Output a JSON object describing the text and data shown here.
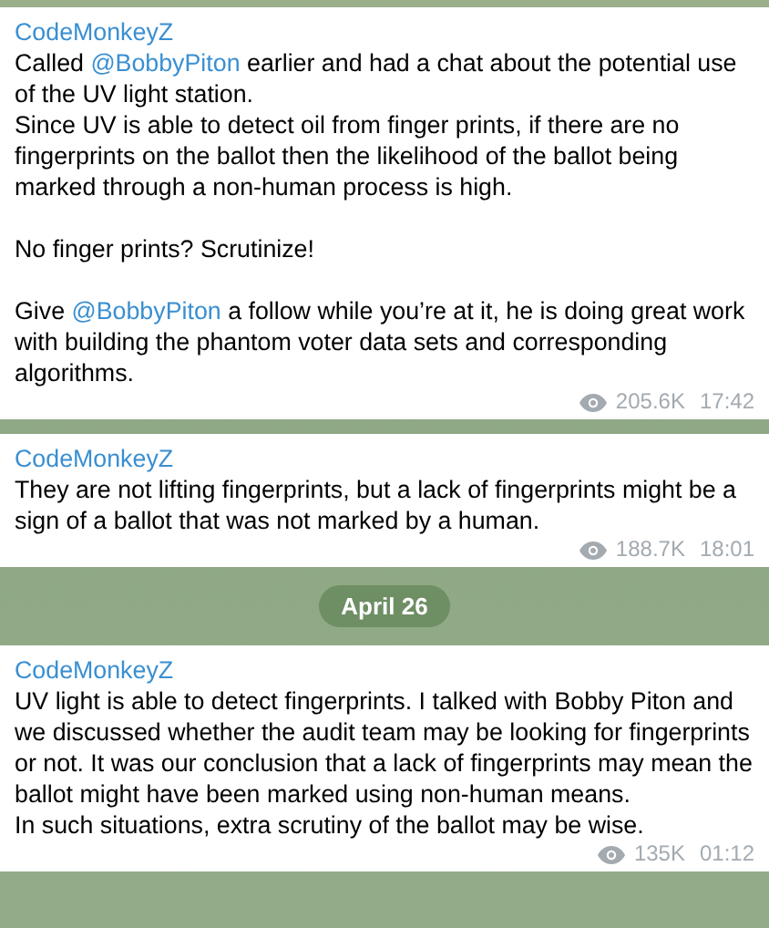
{
  "items": [
    {
      "kind": "message",
      "author": "CodeMonkeyZ",
      "groups": [
        [
          [
            {
              "kind": "plain",
              "text": "Called "
            },
            {
              "kind": "mention",
              "text": "@BobbyPiton"
            },
            {
              "kind": "plain",
              "text": " earlier and had a chat about the potential use of the UV light station."
            }
          ],
          [
            {
              "kind": "plain",
              "text": "Since UV is able to detect oil from finger prints, if there are no fingerprints on the ballot then the likelihood of the ballot being marked through a non-human process is high."
            }
          ]
        ],
        [
          [
            {
              "kind": "plain",
              "text": "No finger prints? Scrutinize!"
            }
          ]
        ],
        [
          [
            {
              "kind": "plain",
              "text": "Give "
            },
            {
              "kind": "mention",
              "text": "@BobbyPiton"
            },
            {
              "kind": "plain",
              "text": " a follow while you’re at it, he is doing great work with building the phantom voter data sets and corresponding algorithms."
            }
          ]
        ]
      ],
      "views": "205.6K",
      "time": "17:42"
    },
    {
      "kind": "message",
      "author": "CodeMonkeyZ",
      "groups": [
        [
          [
            {
              "kind": "plain",
              "text": "They are not lifting fingerprints, but a lack of fingerprints might be a sign of a ballot that was not marked by a human."
            }
          ]
        ]
      ],
      "views": "188.7K",
      "time": "18:01"
    },
    {
      "kind": "date",
      "text": "April 26"
    },
    {
      "kind": "message",
      "author": "CodeMonkeyZ",
      "groups": [
        [
          [
            {
              "kind": "plain",
              "text": "UV light is able to detect fingerprints. I talked with Bobby Piton and we discussed whether the audit team may be looking for fingerprints or not. It was our conclusion that a lack of fingerprints may mean the ballot might have been marked using non-human means."
            }
          ],
          [
            {
              "kind": "plain",
              "text": "In such situations, extra scrutiny of the ballot may be wise."
            }
          ]
        ]
      ],
      "views": "135K",
      "time": "01:12"
    }
  ]
}
